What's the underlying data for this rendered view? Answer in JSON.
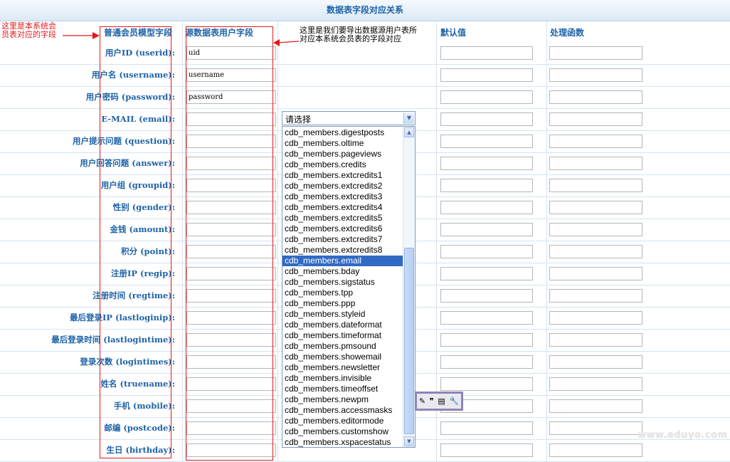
{
  "title": "数据表字段对应关系",
  "headers": {
    "model_field": "普通会员模型字段",
    "source_field": "源数据表用户字段",
    "default_value": "默认值",
    "handler": "处理函数"
  },
  "annotations": {
    "left_line1": "这里是本系统会",
    "left_line2": "员表对应的字段",
    "right_line1": "这里是我们要导出数据源用户表所",
    "right_line2": "对应本系统会员表的字段对应"
  },
  "rows": [
    {
      "label": "用户ID (userid):",
      "source": "uid"
    },
    {
      "label": "用户名 (username):",
      "source": "username"
    },
    {
      "label": "用户密码 (password):",
      "source": "password"
    },
    {
      "label": "E-MAIL (email):",
      "source": ""
    },
    {
      "label": "用户提示问题 (question):",
      "source": ""
    },
    {
      "label": "用户回答问题 (answer):",
      "source": ""
    },
    {
      "label": "用户组 (groupid):",
      "source": ""
    },
    {
      "label": "性别 (gender):",
      "source": ""
    },
    {
      "label": "金钱 (amount):",
      "source": ""
    },
    {
      "label": "积分 (point):",
      "source": ""
    },
    {
      "label": "注册IP (regip):",
      "source": ""
    },
    {
      "label": "注册时间 (regtime):",
      "source": ""
    },
    {
      "label": "最后登录IP (lastloginip):",
      "source": ""
    },
    {
      "label": "最后登录时间 (lastlogintime):",
      "source": ""
    },
    {
      "label": "登录次数 (logintimes):",
      "source": ""
    },
    {
      "label": "姓名 (truename):",
      "source": ""
    },
    {
      "label": "手机 (mobile):",
      "source": ""
    },
    {
      "label": "邮编 (postcode):",
      "source": ""
    },
    {
      "label": "生日 (birthday):",
      "source": ""
    }
  ],
  "select": {
    "placeholder": "请选择",
    "options": [
      "cdb_members.digestposts",
      "cdb_members.oltime",
      "cdb_members.pageviews",
      "cdb_members.credits",
      "cdb_members.extcredits1",
      "cdb_members.extcredits2",
      "cdb_members.extcredits3",
      "cdb_members.extcredits4",
      "cdb_members.extcredits5",
      "cdb_members.extcredits6",
      "cdb_members.extcredits7",
      "cdb_members.extcredits8",
      "cdb_members.email",
      "cdb_members.bday",
      "cdb_members.sigstatus",
      "cdb_members.tpp",
      "cdb_members.ppp",
      "cdb_members.styleid",
      "cdb_members.dateformat",
      "cdb_members.timeformat",
      "cdb_members.pmsound",
      "cdb_members.showemail",
      "cdb_members.newsletter",
      "cdb_members.invisible",
      "cdb_members.timeoffset",
      "cdb_members.newpm",
      "cdb_members.accessmasks",
      "cdb_members.editormode",
      "cdb_members.customshow",
      "cdb_members.xspacestatus"
    ],
    "highlighted": "cdb_members.email"
  },
  "toolbar_icons": [
    "eraser-icon",
    "quote-icon",
    "table-icon",
    "wrench-icon"
  ],
  "watermark": "www.eduyo.com",
  "colors": {
    "header_text": "#1e63a8",
    "annotation_red": "#e21a1a",
    "selection": "#316ac5"
  }
}
